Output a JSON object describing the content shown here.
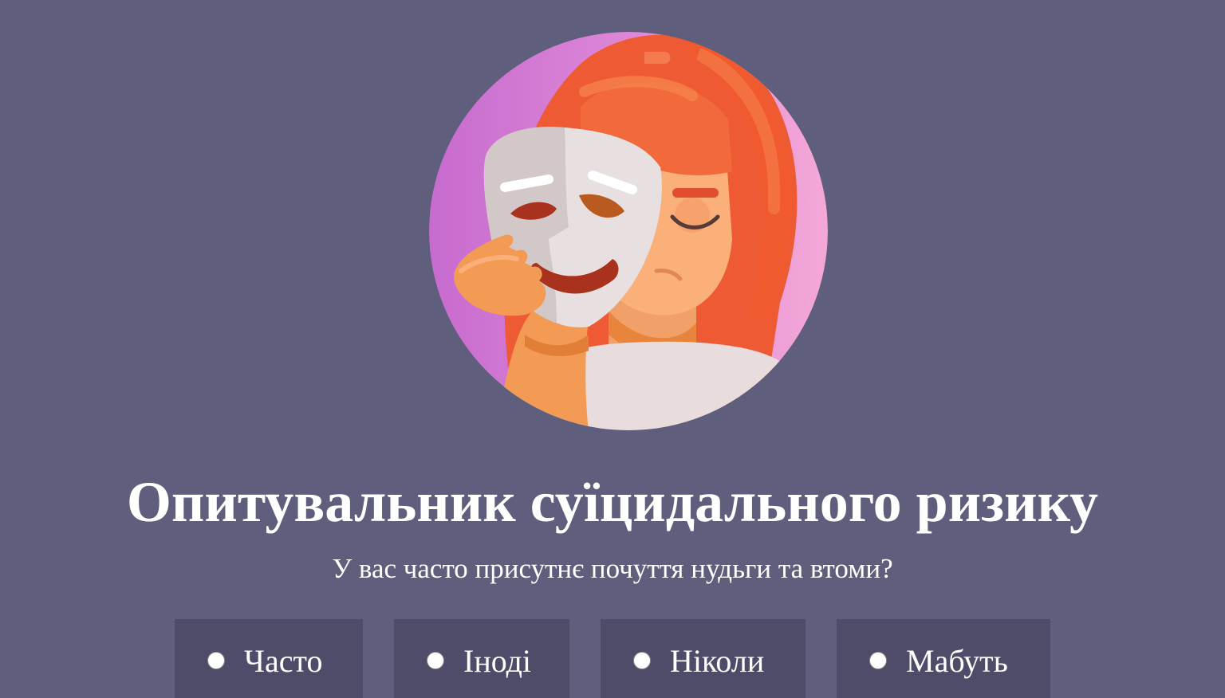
{
  "quiz": {
    "title": "Опитувальник суїцидального ризику",
    "question": "У вас часто присутнє почуття нудьги та втоми?",
    "illustration": "person-holding-theatre-mask-illustration",
    "options": [
      {
        "label": "Часто",
        "selected": false
      },
      {
        "label": "Іноді",
        "selected": false
      },
      {
        "label": "Ніколи",
        "selected": false
      },
      {
        "label": "Мабуть",
        "selected": false
      }
    ]
  },
  "colors": {
    "background": "#5f5e7c",
    "option_background": "#4f4c69",
    "text": "#ffffff",
    "hair": "#f26a3b",
    "circle_left": "#c86ccf",
    "circle_right": "#f3a6d6"
  }
}
